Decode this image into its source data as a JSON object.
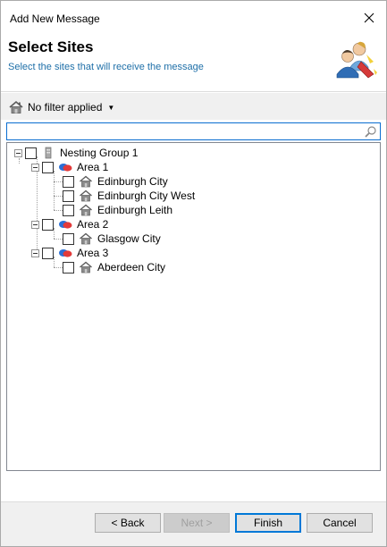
{
  "window": {
    "title": "Add New Message"
  },
  "header": {
    "title": "Select Sites",
    "subtitle": "Select the sites that will receive the message",
    "icon": "users-message-icon"
  },
  "toolbar": {
    "filter_label": "No filter applied",
    "filter_icon": "house-icon"
  },
  "search": {
    "value": "",
    "placeholder": ""
  },
  "tree": {
    "root": {
      "label": "Nesting Group 1",
      "icon": "building-icon",
      "checked": false,
      "expanded": true
    },
    "areas": [
      {
        "label": "Area 1",
        "icon": "area-blobs-icon",
        "checked": false,
        "expanded": true,
        "sites": [
          {
            "label": "Edinburgh City",
            "icon": "house-icon",
            "checked": false
          },
          {
            "label": "Edinburgh City West",
            "icon": "house-icon",
            "checked": false
          },
          {
            "label": "Edinburgh Leith",
            "icon": "house-icon",
            "checked": false
          }
        ]
      },
      {
        "label": "Area 2",
        "icon": "area-blobs-icon",
        "checked": false,
        "expanded": true,
        "sites": [
          {
            "label": "Glasgow City",
            "icon": "house-icon",
            "checked": false
          }
        ]
      },
      {
        "label": "Area 3",
        "icon": "area-blobs-icon",
        "checked": false,
        "expanded": true,
        "sites": [
          {
            "label": "Aberdeen City",
            "icon": "house-icon",
            "checked": false
          }
        ]
      }
    ]
  },
  "footer": {
    "back_label": "< Back",
    "next_label": "Next >",
    "finish_label": "Finish",
    "cancel_label": "Cancel",
    "next_enabled": false
  },
  "colors": {
    "accent": "#0078d7",
    "subtitle": "#1e6fa8",
    "footer_bg": "#f0f0f0"
  }
}
